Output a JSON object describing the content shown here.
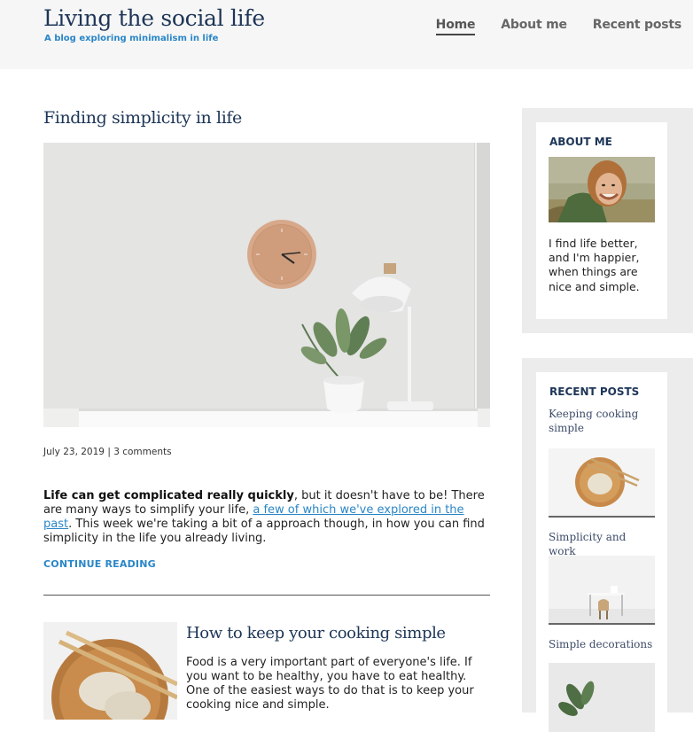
{
  "site": {
    "title": "Living the social life",
    "tagline": "A blog exploring minimalism in life"
  },
  "nav": {
    "items": [
      {
        "label": "Home",
        "active": true
      },
      {
        "label": "About me",
        "active": false
      },
      {
        "label": "Recent posts",
        "active": false
      }
    ]
  },
  "post1": {
    "title": "Finding simplicity in life",
    "date": "July 23, 2019",
    "separator": "|",
    "comments": "3 comments",
    "excerpt_bold": "Life can get complicated really quickly",
    "excerpt_part1": ", but it doesn't have to be! There are many ways to simplify your life, ",
    "excerpt_link": "a few of which we've explored in the past",
    "excerpt_part2": ". This week we're taking a bit of a approach though, in how you can find simplicity in the life you already living.",
    "continue_label": "CONTINUE READING"
  },
  "post2": {
    "title": "How to keep your cooking simple",
    "excerpt": "Food is a very important part of everyone's life. If you want to be healthy, you have to eat healthy. One of the easiest ways to do that is to keep your cooking nice and simple."
  },
  "sidebar": {
    "about": {
      "heading": "ABOUT ME",
      "text": "I find life better, and I'm happier, when things are nice and simple."
    },
    "recent": {
      "heading": "RECENT POSTS",
      "posts": [
        {
          "title": "Keeping cooking simple"
        },
        {
          "title": "Simplicity and work"
        },
        {
          "title": "Simple decorations"
        }
      ]
    }
  },
  "colors": {
    "accent": "#2a86c7",
    "title_navy": "#1d3557",
    "header_bg": "#f6f6f6",
    "sidebar_bg": "#ececec"
  }
}
